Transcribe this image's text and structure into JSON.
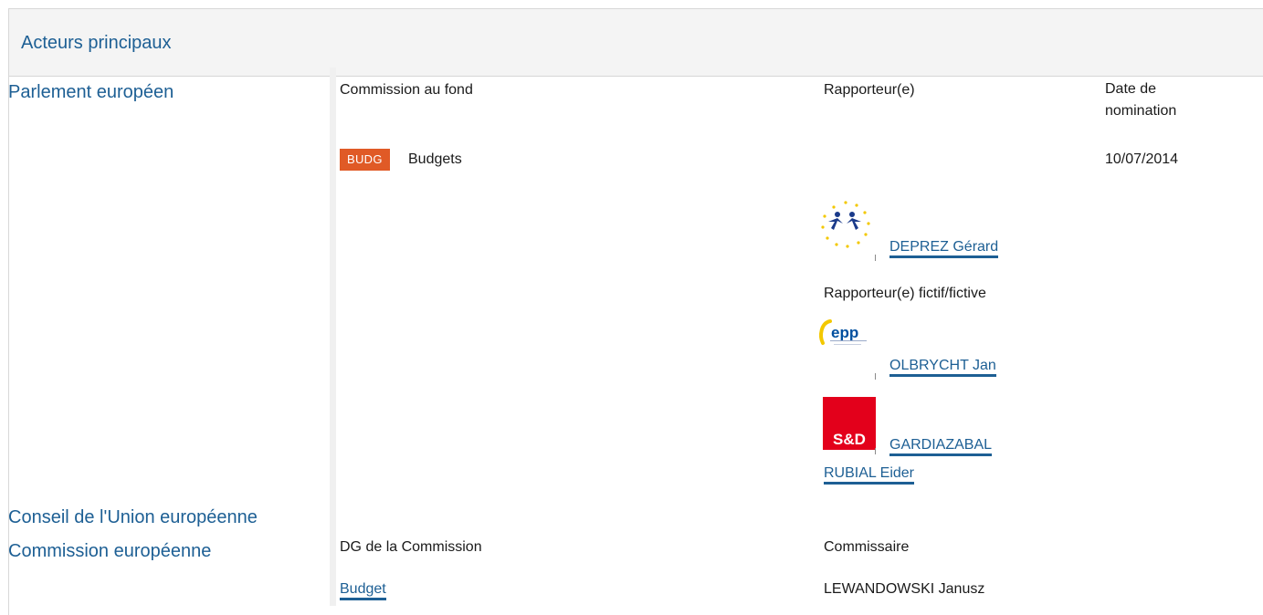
{
  "panel": {
    "title": "Acteurs principaux"
  },
  "institutions": {
    "parliament": "Parlement européen",
    "council": "Conseil de l'Union européenne",
    "commission": "Commission européenne"
  },
  "parliament_table": {
    "headers": {
      "committee": "Commission au fond",
      "rapporteur": "Rapporteur(e)",
      "date": "Date de nomination"
    },
    "committee_code": "BUDG",
    "committee_name": "Budgets",
    "date": "10/07/2014",
    "rapporteur": {
      "name": "DEPREZ Gérard",
      "group_logo": "alde-logo-icon"
    },
    "shadow_label": "Rapporteur(e) fictif/fictive",
    "shadows": [
      {
        "name": "OLBRYCHT Jan",
        "group_logo": "epp-logo-icon",
        "logo_text": "epp"
      },
      {
        "name": "GARDIAZABAL RUBIAL Eider",
        "group_logo": "sd-logo-icon",
        "logo_text": "S&D"
      }
    ]
  },
  "commission_table": {
    "headers": {
      "dg": "DG de la Commission",
      "commissioner": "Commissaire"
    },
    "dg": "Budget",
    "commissioner": "LEWANDOWSKI Janusz"
  },
  "colors": {
    "link": "#1d5f94",
    "badge": "#e05a26",
    "header_bg": "#f4f4f4",
    "sd_red": "#e3001b",
    "epp_blue": "#004f9f",
    "alde_blue": "#1a3a8a",
    "alde_star": "#f3c800"
  }
}
